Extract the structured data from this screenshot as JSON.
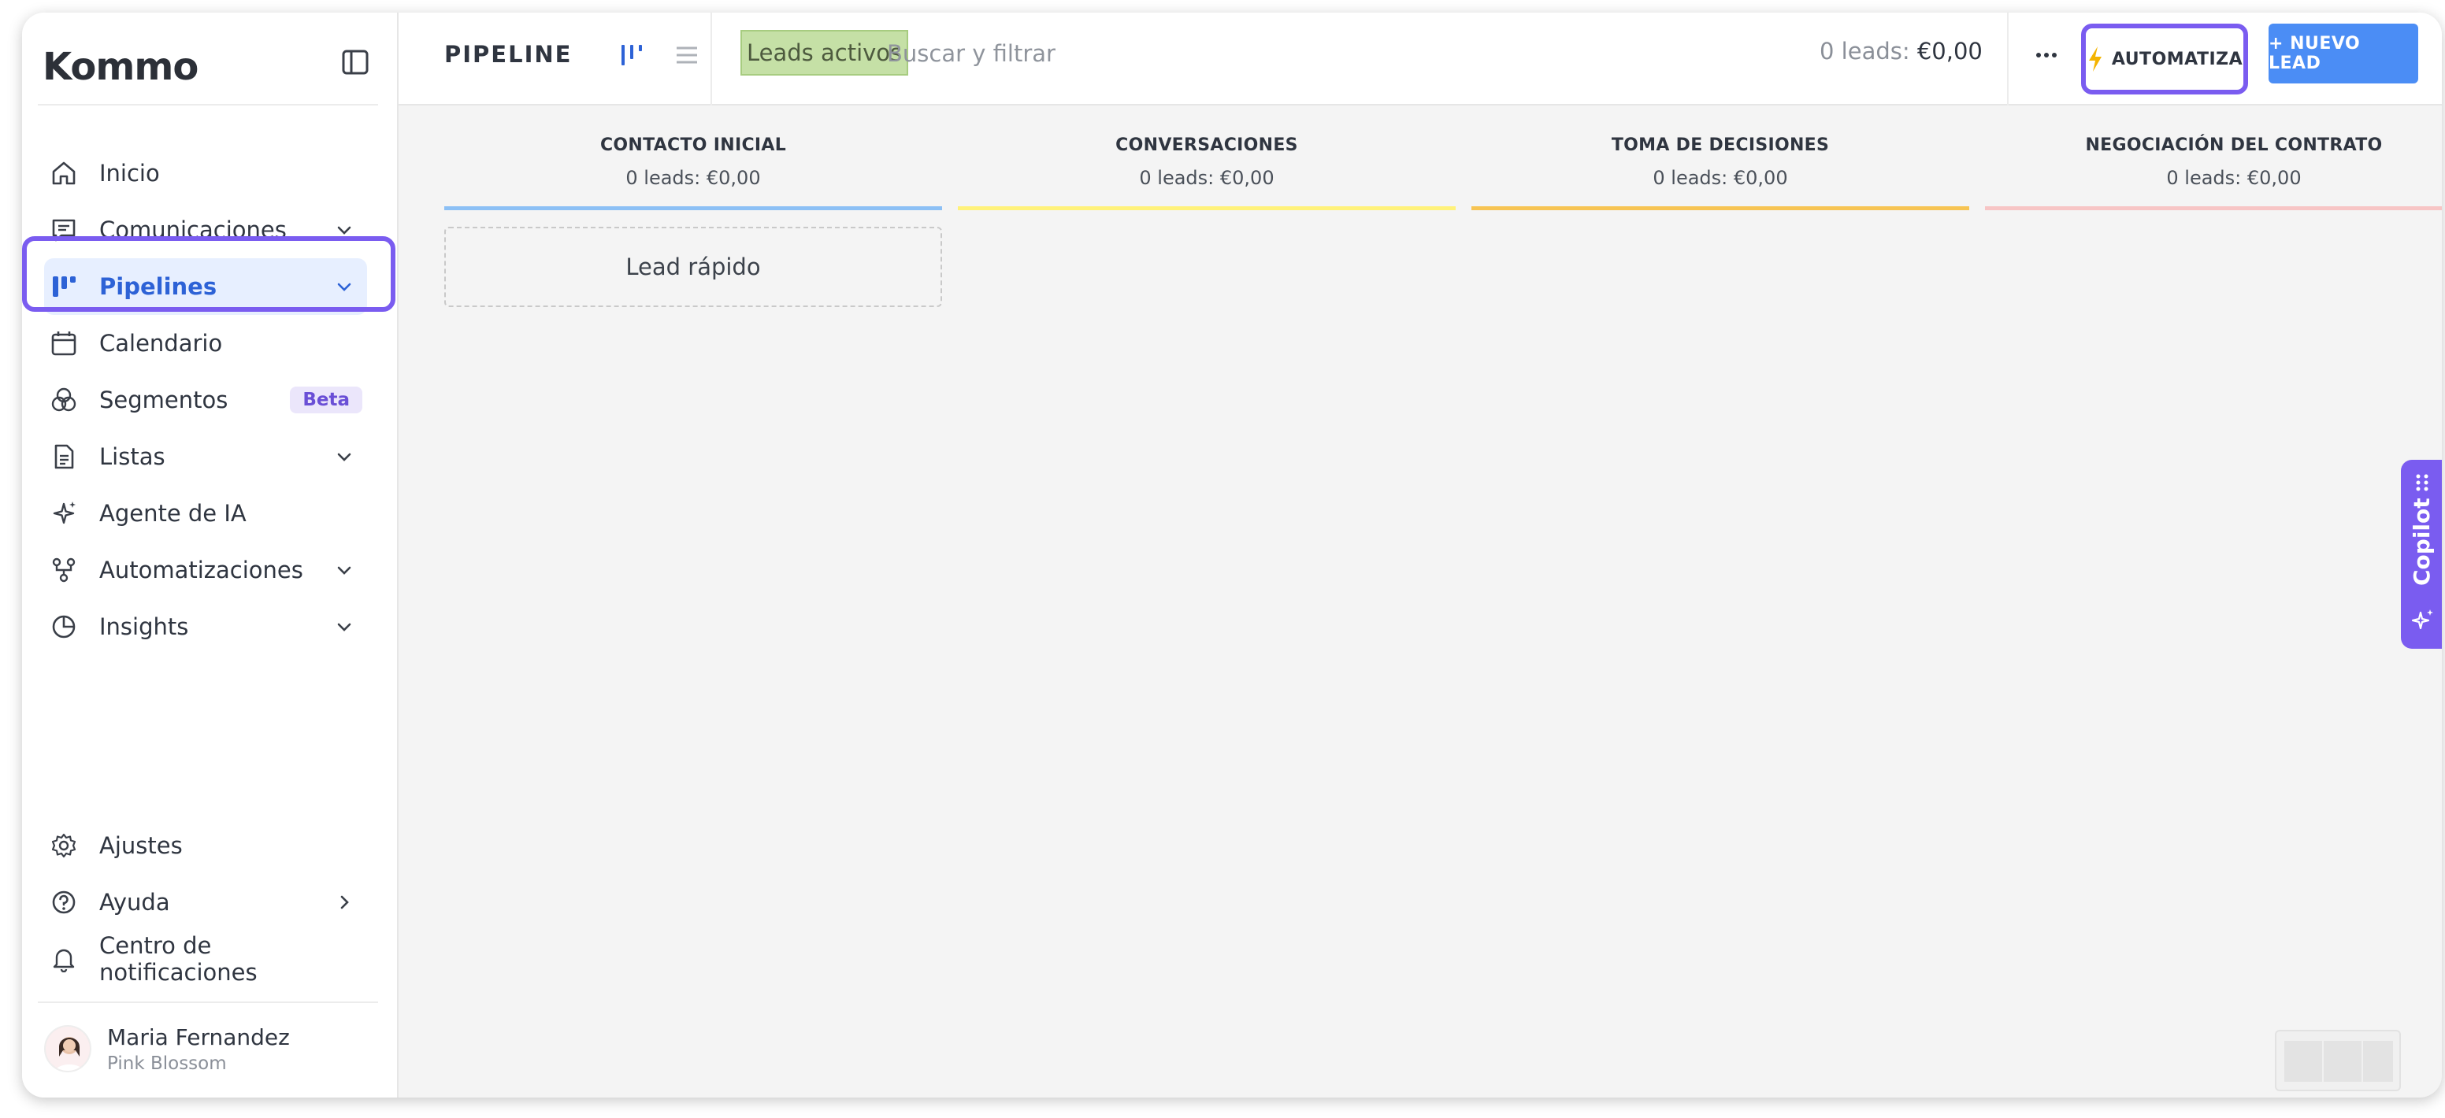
{
  "sidebar": {
    "logo": "Kommo",
    "items": [
      {
        "key": "inicio",
        "label": "Inicio",
        "icon": "home-icon",
        "chevron": false
      },
      {
        "key": "comunicaciones",
        "label": "Comunicaciones",
        "icon": "chat-icon",
        "chevron": true
      },
      {
        "key": "pipelines",
        "label": "Pipelines",
        "icon": "pipeline-icon",
        "chevron": true,
        "active": true
      },
      {
        "key": "calendario",
        "label": "Calendario",
        "icon": "calendar-icon",
        "chevron": false
      },
      {
        "key": "segmentos",
        "label": "Segmentos",
        "icon": "segments-icon",
        "badge": "Beta"
      },
      {
        "key": "listas",
        "label": "Listas",
        "icon": "document-icon",
        "chevron": true
      },
      {
        "key": "agente",
        "label": "Agente de IA",
        "icon": "sparkle-icon",
        "chevron": false
      },
      {
        "key": "automatizaciones",
        "label": "Automatizaciones",
        "icon": "flow-icon",
        "chevron": true
      },
      {
        "key": "insights",
        "label": "Insights",
        "icon": "pie-chart-icon",
        "chevron": true
      }
    ],
    "bottom_items": [
      {
        "key": "ajustes",
        "label": "Ajustes",
        "icon": "gear-icon"
      },
      {
        "key": "ayuda",
        "label": "Ayuda",
        "icon": "help-icon"
      },
      {
        "key": "notificaciones",
        "label": "Centro de notificaciones",
        "icon": "bell-icon"
      }
    ],
    "user": {
      "name": "Maria Fernandez",
      "org": "Pink Blossom"
    }
  },
  "topbar": {
    "title": "PIPELINE",
    "filter_chip": "Leads activos",
    "search_placeholder": "Buscar y filtrar",
    "lead_count_prefix": "0 leads: ",
    "lead_count_value": "€0,00",
    "automate_label": "AUTOMATIZA",
    "new_lead_label": "+ NUEVO LEAD"
  },
  "columns": [
    {
      "title": "CONTACTO INICIAL",
      "summary": "0 leads: €0,00",
      "color": "#8cc0f5"
    },
    {
      "title": "CONVERSACIONES",
      "summary": "0 leads: €0,00",
      "color": "#fff27a"
    },
    {
      "title": "TOMA DE DECISIONES",
      "summary": "0 leads: €0,00",
      "color": "#f7c453"
    },
    {
      "title": "NEGOCIACIÓN DEL CONTRATO",
      "summary": "0 leads: €0,00",
      "color": "#f7c5c5"
    }
  ],
  "quick_lead_label": "Lead rápido",
  "copilot_label": "Copilot",
  "colors": {
    "accent": "#7a5cf0",
    "primary": "#4b8df5",
    "active_text": "#2d62d6"
  }
}
